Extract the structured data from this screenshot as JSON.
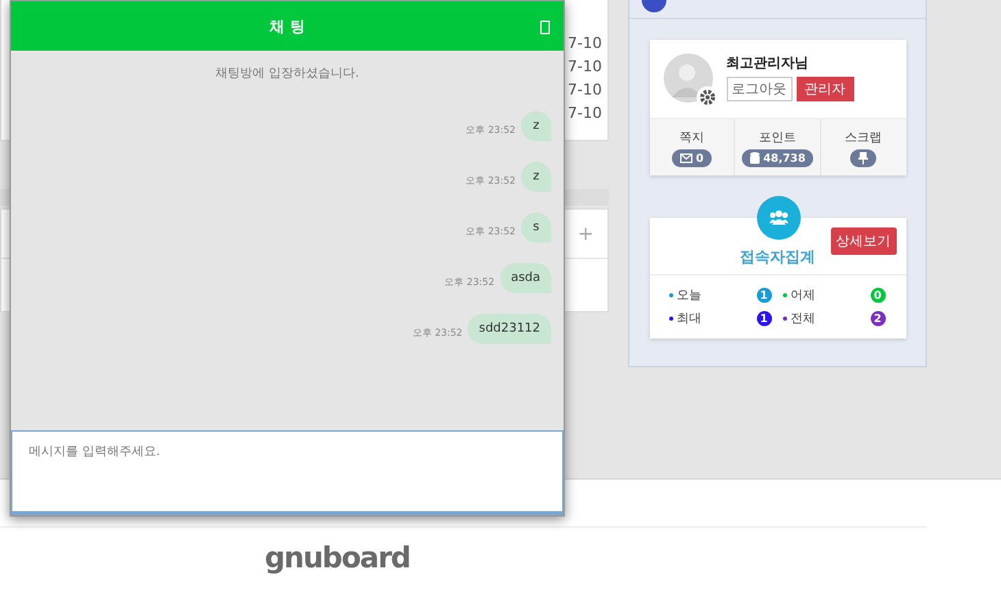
{
  "background": {
    "dates": [
      "7-10",
      "7-10",
      "7-10",
      "7-10"
    ],
    "add_symbol": "+"
  },
  "chat": {
    "title": "채 팅",
    "notice": "채팅방에 입장하셨습니다.",
    "input": {
      "placeholder": "메시지를 입력해주세요."
    },
    "messages": [
      {
        "time": "오후 23:52",
        "text": "z"
      },
      {
        "time": "오후 23:52",
        "text": "z"
      },
      {
        "time": "오후 23:52",
        "text": "s"
      },
      {
        "time": "오후 23:52",
        "text": "asda"
      },
      {
        "time": "오후 23:52",
        "text": "sdd23112"
      }
    ]
  },
  "profile": {
    "name": "최고관리자님",
    "logout": "로그아웃",
    "admin": "관리자",
    "stats": [
      {
        "kind": "memo",
        "label": "쪽지",
        "value": "0"
      },
      {
        "kind": "point",
        "label": "포인트",
        "value": "48,738"
      },
      {
        "kind": "scrap",
        "label": "스크랩"
      }
    ]
  },
  "visitors": {
    "title": "접속자집계",
    "detail_button": "상세보기",
    "items": [
      {
        "label": "오늘",
        "count": "1",
        "color": "#1a9ad6"
      },
      {
        "label": "어제",
        "count": "0",
        "color": "#00c73c"
      },
      {
        "label": "최대",
        "count": "1",
        "color": "#2b14f0"
      },
      {
        "label": "전체",
        "count": "2",
        "color": "#7a2fc0"
      }
    ]
  },
  "footer": {
    "logo": "gnuboard"
  }
}
